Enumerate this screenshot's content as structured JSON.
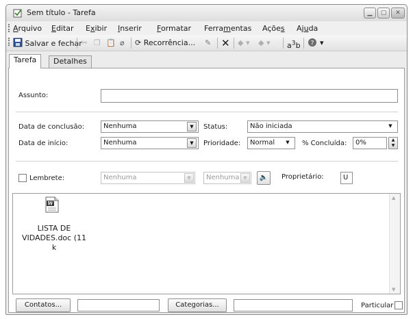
{
  "window": {
    "title": "Sem título - Tarefa"
  },
  "menu": [
    {
      "pre": "",
      "u": "A",
      "post": "rquivo"
    },
    {
      "pre": "",
      "u": "E",
      "post": "ditar"
    },
    {
      "pre": "E",
      "u": "x",
      "post": "ibir"
    },
    {
      "pre": "",
      "u": "I",
      "post": "nserir"
    },
    {
      "pre": "",
      "u": "F",
      "post": "ormatar"
    },
    {
      "pre": "Ferra",
      "u": "m",
      "post": "entas"
    },
    {
      "pre": "Açõe",
      "u": "s",
      "post": ""
    },
    {
      "pre": "Aj",
      "u": "u",
      "post": "da"
    }
  ],
  "toolbar": {
    "save_close": "Salvar e fechar",
    "recurrence": "Recorrência..."
  },
  "tabs": {
    "task": "Tarefa",
    "details": "Detalhes"
  },
  "form": {
    "subject_label": "Assunto:",
    "subject_value": "",
    "due_label": "Data de conclusão:",
    "due_value": "Nenhuma",
    "start_label": "Data de início:",
    "start_value": "Nenhuma",
    "status_label": "Status:",
    "status_value": "Não iniciada",
    "priority_label": "Prioridade:",
    "priority_value": "Normal",
    "percent_label": "% Concluída:",
    "percent_value": "0%",
    "reminder_label": "Lembrete:",
    "reminder_date": "Nenhuma",
    "reminder_time": "Nenhuma",
    "owner_label": "Proprietário:",
    "owner_value": "U"
  },
  "attachment": {
    "name_line1": "LISTA DE",
    "name_line2": "VIDADES.doc (11 k"
  },
  "bottom": {
    "contacts_button": "Contatos...",
    "contacts_value": "",
    "categories_button": "Categorias...",
    "categories_value": "",
    "private_label": "Particular"
  }
}
